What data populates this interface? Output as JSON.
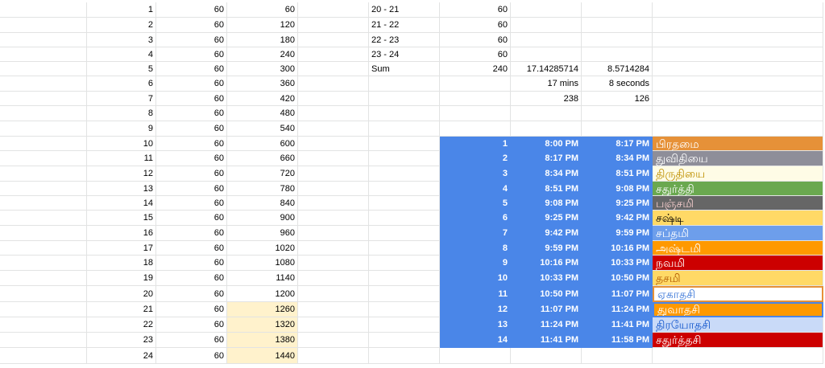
{
  "colors": {
    "gridline": "#e2e3e3",
    "highlight": "#fff2cc",
    "blue": "#4a86e8",
    "white": "#ffffff"
  },
  "sheet": {
    "rows": [
      {
        "a": "1",
        "b": "60",
        "c": "60",
        "e": "20 - 21",
        "f": "60",
        "g": "",
        "h": "",
        "i": ""
      },
      {
        "a": "2",
        "b": "60",
        "c": "120",
        "e": "21 - 22",
        "f": "60",
        "g": "",
        "h": "",
        "i": ""
      },
      {
        "a": "3",
        "b": "60",
        "c": "180",
        "e": "22 - 23",
        "f": "60",
        "g": "",
        "h": "",
        "i": ""
      },
      {
        "a": "4",
        "b": "60",
        "c": "240",
        "e": "23 - 24",
        "f": "60",
        "g": "",
        "h": "",
        "i": ""
      },
      {
        "a": "5",
        "b": "60",
        "c": "300",
        "e": "Sum",
        "f": "240",
        "g": "17.14285714",
        "h": "8.5714284",
        "i": ""
      },
      {
        "a": "6",
        "b": "60",
        "c": "360",
        "e": "",
        "f": "",
        "g": "17 mins",
        "h": "8 seconds",
        "i": ""
      },
      {
        "a": "7",
        "b": "60",
        "c": "420",
        "e": "",
        "f": "",
        "g": "238",
        "h": "126",
        "i": ""
      },
      {
        "a": "8",
        "b": "60",
        "c": "480",
        "e": "",
        "f": "",
        "g": "",
        "h": "",
        "i": ""
      },
      {
        "a": "9",
        "b": "60",
        "c": "540",
        "e": "",
        "f": "",
        "g": "",
        "h": "",
        "i": ""
      },
      {
        "a": "10",
        "b": "60",
        "c": "600",
        "e": "",
        "f": "1",
        "g": "8:00 PM",
        "h": "8:17 PM",
        "i": "பிரதமை",
        "ibg": "#e69138",
        "ifg": "#ffffff"
      },
      {
        "a": "11",
        "b": "60",
        "c": "660",
        "e": "",
        "f": "2",
        "g": "8:17 PM",
        "h": "8:34 PM",
        "i": "துவிதியை",
        "ibg": "#8e8e99",
        "ifg": "#ffffff"
      },
      {
        "a": "12",
        "b": "60",
        "c": "720",
        "e": "",
        "f": "3",
        "g": "8:34 PM",
        "h": "8:51 PM",
        "i": "திருதியை",
        "ibg": "#fefce6",
        "ifg": "#bf9000"
      },
      {
        "a": "13",
        "b": "60",
        "c": "780",
        "e": "",
        "f": "4",
        "g": "8:51 PM",
        "h": "9:08 PM",
        "i": "சதுர்த்தி",
        "ibg": "#6aa84f",
        "ifg": "#ffffff"
      },
      {
        "a": "14",
        "b": "60",
        "c": "840",
        "e": "",
        "f": "5",
        "g": "9:08 PM",
        "h": "9:25 PM",
        "i": "பஞ்சமி",
        "ibg": "#666666",
        "ifg": "#f4cccc"
      },
      {
        "a": "15",
        "b": "60",
        "c": "900",
        "e": "",
        "f": "6",
        "g": "9:25 PM",
        "h": "9:42 PM",
        "i": "சஷ்டி",
        "ibg": "#ffd966",
        "ifg": "#000000"
      },
      {
        "a": "16",
        "b": "60",
        "c": "960",
        "e": "",
        "f": "7",
        "g": "9:42 PM",
        "h": "9:59 PM",
        "i": "சப்தமி",
        "ibg": "#6d9eeb",
        "ifg": "#ffffff"
      },
      {
        "a": "17",
        "b": "60",
        "c": "1020",
        "e": "",
        "f": "8",
        "g": "9:59 PM",
        "h": "10:16 PM",
        "i": "அஷ்டமி",
        "ibg": "#ff9900",
        "ifg": "#ffffff"
      },
      {
        "a": "18",
        "b": "60",
        "c": "1080",
        "e": "",
        "f": "9",
        "g": "10:16 PM",
        "h": "10:33 PM",
        "i": "நவமி",
        "ibg": "#cc0000",
        "ifg": "#ffffff"
      },
      {
        "a": "19",
        "b": "60",
        "c": "1140",
        "e": "",
        "f": "10",
        "g": "10:33 PM",
        "h": "10:50 PM",
        "i": "தசமி",
        "ibg": "#ffd966",
        "ifg": "#b45f06"
      },
      {
        "a": "20",
        "b": "60",
        "c": "1200",
        "e": "",
        "f": "11",
        "g": "10:50 PM",
        "h": "11:07 PM",
        "i": "ஏகாதசி",
        "ibg": "#ffffff",
        "ifg": "#3c78d8",
        "iborder": "#e69138"
      },
      {
        "a": "21",
        "b": "60",
        "c": "1260",
        "cbg": "#fff2cc",
        "e": "",
        "f": "12",
        "g": "11:07 PM",
        "h": "11:24 PM",
        "i": "துவாதசி",
        "ibg": "#ff9900",
        "ifg": "#ffffff",
        "iborder": "#4a86e8"
      },
      {
        "a": "22",
        "b": "60",
        "c": "1320",
        "cbg": "#fff2cc",
        "e": "",
        "f": "13",
        "g": "11:24 PM",
        "h": "11:41 PM",
        "i": "திரயோதசி",
        "ibg": "#c9daf8",
        "ifg": "#1155cc"
      },
      {
        "a": "23",
        "b": "60",
        "c": "1380",
        "cbg": "#fff2cc",
        "e": "",
        "f": "14",
        "g": "11:41 PM",
        "h": "11:58 PM",
        "i": "சதுர்த்தசி",
        "ibg": "#cc0000",
        "ifg": "#ffffff"
      },
      {
        "a": "24",
        "b": "60",
        "c": "1440",
        "cbg": "#fff2cc",
        "e": "",
        "f": "",
        "g": "",
        "h": "",
        "i": ""
      }
    ]
  }
}
